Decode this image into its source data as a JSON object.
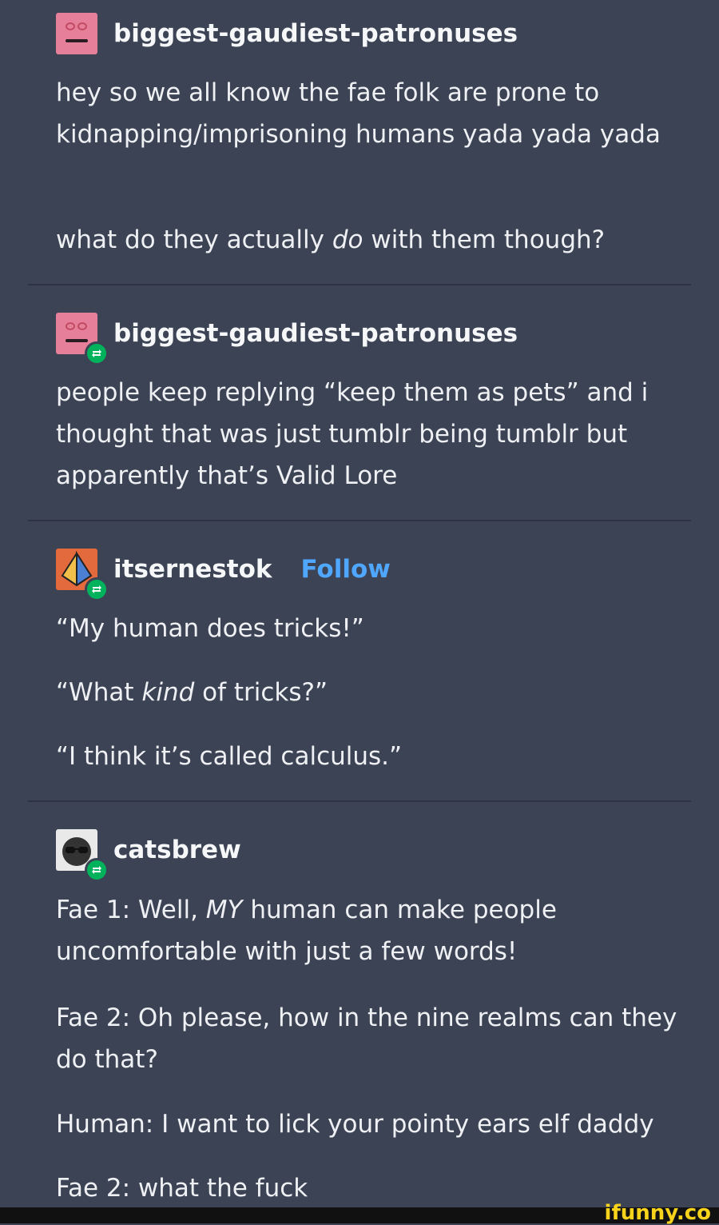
{
  "posts": [
    {
      "username": "biggest-gaudiest-patronuses",
      "avatar_icon": "pink-face-avatar",
      "reblogged": false,
      "paragraphs": [
        "hey so we all know the fae folk are prone to kidnapping/imprisoning humans yada yada yada",
        [
          "what do they actually ",
          "do",
          " with them though?"
        ]
      ]
    },
    {
      "username": "biggest-gaudiest-patronuses",
      "avatar_icon": "pink-face-avatar",
      "reblogged": true,
      "paragraphs": [
        "people keep replying “keep them as pets” and i thought that was just tumblr being tumblr but apparently that’s Valid Lore"
      ]
    },
    {
      "username": "itsernestok",
      "follow_label": "Follow",
      "avatar_icon": "triangle-avatar",
      "reblogged": true,
      "paragraphs": [
        "“My human does tricks!”",
        [
          "“What ",
          "kind",
          " of tricks?”"
        ],
        "“I think it’s called calculus.”"
      ]
    },
    {
      "username": "catsbrew",
      "avatar_icon": "sunglasses-avatar",
      "reblogged": true,
      "paragraphs": [
        [
          "Fae 1: Well, ",
          "MY",
          " human can make people uncomfortable with just a few words!"
        ],
        "Fae 2: Oh please, how in the nine realms can they do that?",
        "Human: I want to lick your pointy ears elf daddy",
        "Fae 2: what the fuck"
      ]
    }
  ],
  "watermark": "ifunny.co",
  "colors": {
    "background": "#3b4354",
    "follow": "#4fa7ff",
    "reblog_badge": "#00b25b",
    "watermark": "#f8d31c"
  }
}
